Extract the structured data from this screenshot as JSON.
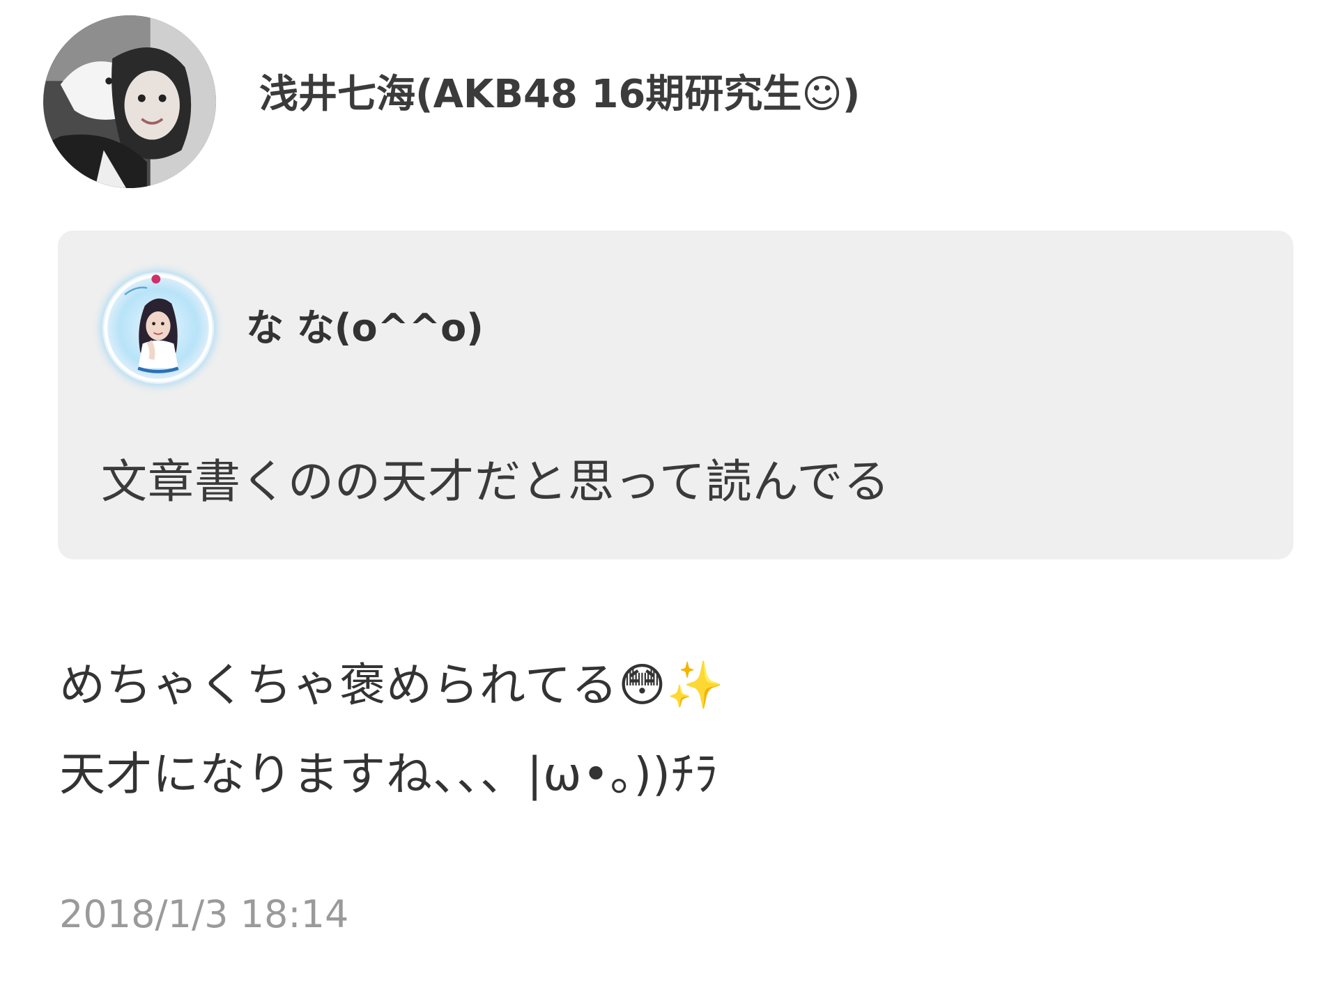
{
  "author": {
    "name": "浅井七海(AKB48 16期研究生☺)",
    "avatar_icon": "profile-photo"
  },
  "quoted_comment": {
    "author_name": "な な(o^^o)",
    "avatar_icon": "profile-photo",
    "text": "文章書くのの天才だと思って読んでる"
  },
  "post": {
    "lines": [
      "めちゃくちゃ褒められてる😳✨",
      "天才になりますね、、、|ω•。))ﾁﾗ"
    ],
    "timestamp": "2018/1/3 18:14"
  },
  "colors": {
    "background": "#ffffff",
    "quote_background": "#efefef",
    "text": "#333333",
    "timestamp": "#9a9a9a",
    "quote_avatar_glow": "#aadcf5"
  }
}
